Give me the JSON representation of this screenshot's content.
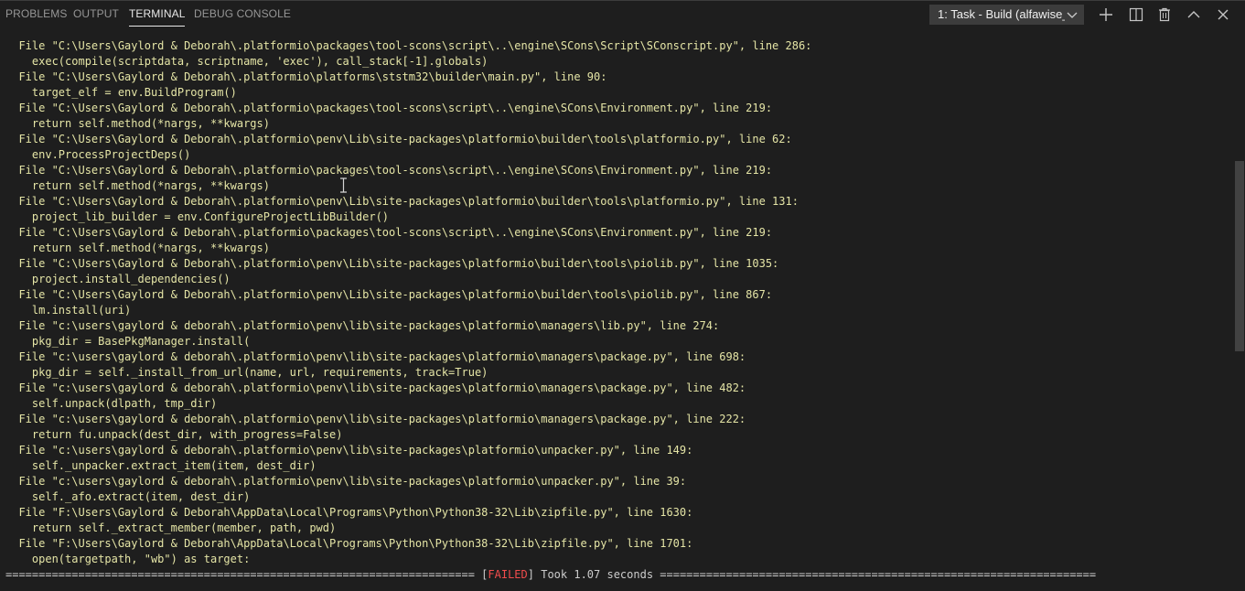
{
  "tabs": [
    {
      "label": "PROBLEMS",
      "active": false
    },
    {
      "label": "OUTPUT",
      "active": false
    },
    {
      "label": "TERMINAL",
      "active": true
    },
    {
      "label": "DEBUG CONSOLE",
      "active": false
    }
  ],
  "terminal_select": {
    "value": "1: Task - Build (alfawise_"
  },
  "actions": [
    "new-terminal",
    "split-terminal",
    "kill-terminal",
    "maximize-panel",
    "close-panel"
  ],
  "terminal": {
    "lines": [
      {
        "kind": "file",
        "text": "  File \"C:\\Users\\Gaylord & Deborah\\.platformio\\packages\\tool-scons\\script\\..\\engine\\SCons\\Script\\SConscript.py\", line 286:"
      },
      {
        "kind": "code",
        "text": "    exec(compile(scriptdata, scriptname, 'exec'), call_stack[-1].globals)"
      },
      {
        "kind": "file",
        "text": "  File \"C:\\Users\\Gaylord & Deborah\\.platformio\\platforms\\ststm32\\builder\\main.py\", line 90:"
      },
      {
        "kind": "code",
        "text": "    target_elf = env.BuildProgram()"
      },
      {
        "kind": "file",
        "text": "  File \"C:\\Users\\Gaylord & Deborah\\.platformio\\packages\\tool-scons\\script\\..\\engine\\SCons\\Environment.py\", line 219:"
      },
      {
        "kind": "code",
        "text": "    return self.method(*nargs, **kwargs)"
      },
      {
        "kind": "file",
        "text": "  File \"C:\\Users\\Gaylord & Deborah\\.platformio\\penv\\Lib\\site-packages\\platformio\\builder\\tools\\platformio.py\", line 62:"
      },
      {
        "kind": "code",
        "text": "    env.ProcessProjectDeps()"
      },
      {
        "kind": "file",
        "text": "  File \"C:\\Users\\Gaylord & Deborah\\.platformio\\packages\\tool-scons\\script\\..\\engine\\SCons\\Environment.py\", line 219:"
      },
      {
        "kind": "code",
        "text": "    return self.method(*nargs, **kwargs)"
      },
      {
        "kind": "file",
        "text": "  File \"C:\\Users\\Gaylord & Deborah\\.platformio\\penv\\Lib\\site-packages\\platformio\\builder\\tools\\platformio.py\", line 131:"
      },
      {
        "kind": "code",
        "text": "    project_lib_builder = env.ConfigureProjectLibBuilder()"
      },
      {
        "kind": "file",
        "text": "  File \"C:\\Users\\Gaylord & Deborah\\.platformio\\packages\\tool-scons\\script\\..\\engine\\SCons\\Environment.py\", line 219:"
      },
      {
        "kind": "code",
        "text": "    return self.method(*nargs, **kwargs)"
      },
      {
        "kind": "file",
        "text": "  File \"C:\\Users\\Gaylord & Deborah\\.platformio\\penv\\Lib\\site-packages\\platformio\\builder\\tools\\piolib.py\", line 1035:"
      },
      {
        "kind": "code",
        "text": "    project.install_dependencies()"
      },
      {
        "kind": "file",
        "text": "  File \"C:\\Users\\Gaylord & Deborah\\.platformio\\penv\\Lib\\site-packages\\platformio\\builder\\tools\\piolib.py\", line 867:"
      },
      {
        "kind": "code",
        "text": "    lm.install(uri)"
      },
      {
        "kind": "file",
        "text": "  File \"c:\\users\\gaylord & deborah\\.platformio\\penv\\lib\\site-packages\\platformio\\managers\\lib.py\", line 274:"
      },
      {
        "kind": "code",
        "text": "    pkg_dir = BasePkgManager.install("
      },
      {
        "kind": "file",
        "text": "  File \"c:\\users\\gaylord & deborah\\.platformio\\penv\\lib\\site-packages\\platformio\\managers\\package.py\", line 698:"
      },
      {
        "kind": "code",
        "text": "    pkg_dir = self._install_from_url(name, url, requirements, track=True)"
      },
      {
        "kind": "file",
        "text": "  File \"c:\\users\\gaylord & deborah\\.platformio\\penv\\lib\\site-packages\\platformio\\managers\\package.py\", line 482:"
      },
      {
        "kind": "code",
        "text": "    self.unpack(dlpath, tmp_dir)"
      },
      {
        "kind": "file",
        "text": "  File \"c:\\users\\gaylord & deborah\\.platformio\\penv\\lib\\site-packages\\platformio\\managers\\package.py\", line 222:"
      },
      {
        "kind": "code",
        "text": "    return fu.unpack(dest_dir, with_progress=False)"
      },
      {
        "kind": "file",
        "text": "  File \"c:\\users\\gaylord & deborah\\.platformio\\penv\\lib\\site-packages\\platformio\\unpacker.py\", line 149:"
      },
      {
        "kind": "code",
        "text": "    self._unpacker.extract_item(item, dest_dir)"
      },
      {
        "kind": "file",
        "text": "  File \"c:\\users\\gaylord & deborah\\.platformio\\penv\\lib\\site-packages\\platformio\\unpacker.py\", line 39:"
      },
      {
        "kind": "code",
        "text": "    self._afo.extract(item, dest_dir)"
      },
      {
        "kind": "file",
        "text": "  File \"F:\\Users\\Gaylord & Deborah\\AppData\\Local\\Programs\\Python\\Python38-32\\Lib\\zipfile.py\", line 1630:"
      },
      {
        "kind": "code",
        "text": "    return self._extract_member(member, path, pwd)"
      },
      {
        "kind": "file",
        "text": "  File \"F:\\Users\\Gaylord & Deborah\\AppData\\Local\\Programs\\Python\\Python38-32\\Lib\\zipfile.py\", line 1701:"
      },
      {
        "kind": "code",
        "text": "    open(targetpath, \"wb\") as target:"
      }
    ],
    "summary": {
      "left_rule": "======================================================================= ",
      "bracket_open": "[",
      "status": "FAILED",
      "bracket_close": "]",
      "took": " Took 1.07 seconds ",
      "right_rule": "=================================================================="
    }
  },
  "colors": {
    "background": "#1e1e1e",
    "traceback_text": "#e5e5a6",
    "failed": "#f14c4c",
    "tab_active": "#e7e7e7",
    "tab_inactive": "#969696"
  }
}
